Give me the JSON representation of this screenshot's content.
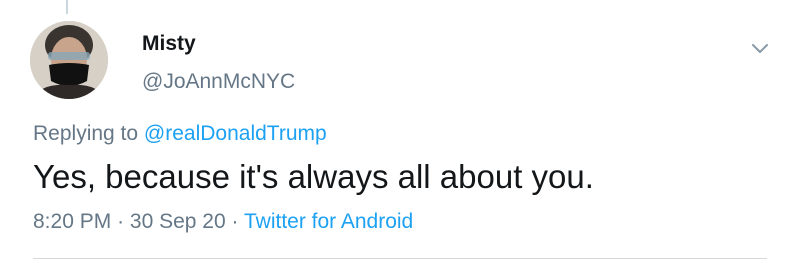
{
  "user": {
    "display_name": "Misty",
    "handle": "@JoAnnMcNYC",
    "avatar_icon": "profile-photo-masked-person"
  },
  "reply": {
    "prefix": "Replying to",
    "mention": "@realDonaldTrump"
  },
  "tweet": {
    "text": "Yes, because it's always all about you."
  },
  "meta": {
    "time": "8:20 PM",
    "separator": "·",
    "date": "30 Sep 20",
    "source": "Twitter for Android"
  },
  "colors": {
    "link": "#1da1f2",
    "secondary_text": "#657786",
    "primary_text": "#14171a"
  },
  "icons": {
    "menu": "chevron-down-icon"
  }
}
